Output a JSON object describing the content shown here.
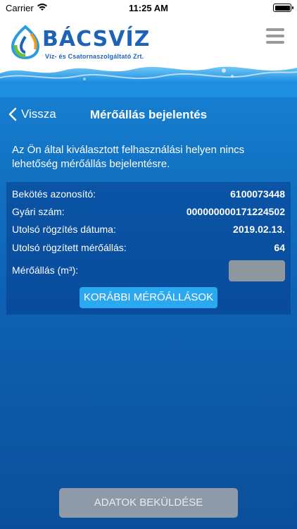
{
  "status_bar": {
    "carrier": "Carrier",
    "time": "11:25 AM",
    "icons": [
      "wifi-icon",
      "battery-icon"
    ]
  },
  "header": {
    "brand": "BÁCSVÍZ",
    "tagline": "Víz- és Csatornaszolgáltató Zrt.",
    "menu_icon": "hamburger-menu-icon"
  },
  "nav": {
    "back_label": "Vissza",
    "title": "Mérőállás bejelentés"
  },
  "info_message": "Az Ön által kiválasztott felhasználási helyen nincs lehetőség mérőállás bejelentésre.",
  "details": {
    "rows": [
      {
        "label": "Bekötés azonosító:",
        "value": "6100073448"
      },
      {
        "label": "Gyári szám:",
        "value": "000000000171224502"
      },
      {
        "label": "Utolsó rögzítés dátuma:",
        "value": "2019.02.13."
      },
      {
        "label": "Utolsó rögzített mérőállás:",
        "value": "64"
      }
    ],
    "meter_label": "Mérőállás (m³):",
    "meter_value": "",
    "history_button": "KORÁBBI MÉRŐÁLLÁSOK"
  },
  "submit_button": "ADATOK BEKÜLDÉSE",
  "colors": {
    "brand_blue": "#1d63b8",
    "accent_button": "#2aa8f0",
    "disabled_button": "#8e9aa8",
    "panel_bg": "#063c8c"
  }
}
